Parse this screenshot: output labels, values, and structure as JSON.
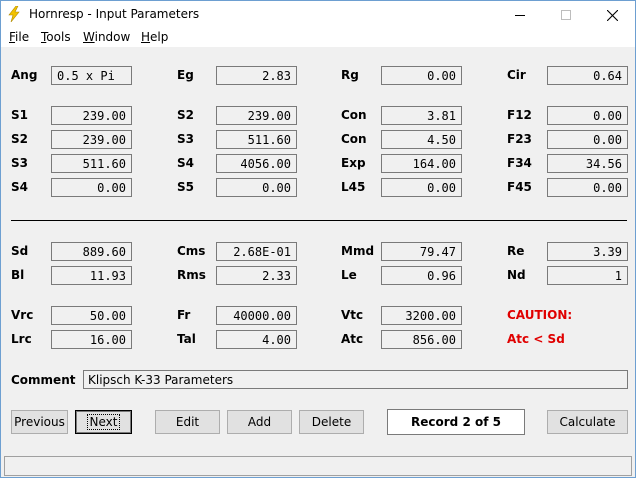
{
  "window": {
    "title": "Hornresp - Input Parameters",
    "app_icon": "lightning-bolt-icon",
    "controls": [
      "minimize-icon",
      "maximize-icon",
      "close-icon"
    ]
  },
  "menu": {
    "file": {
      "accel": "F",
      "rest": "ile"
    },
    "tools": {
      "accel": "T",
      "rest": "ools"
    },
    "window": {
      "accel": "W",
      "rest": "indow"
    },
    "help": {
      "accel": "H",
      "rest": "elp"
    }
  },
  "params": {
    "ang": {
      "label": "Ang",
      "value": "0.5 x Pi"
    },
    "eg": {
      "label": "Eg",
      "value": "2.83"
    },
    "rg": {
      "label": "Rg",
      "value": "0.00"
    },
    "cir": {
      "label": "Cir",
      "value": "0.64"
    },
    "s1": {
      "label": "S1",
      "value": "239.00"
    },
    "s2a": {
      "label": "S2",
      "value": "239.00"
    },
    "con1": {
      "label": "Con",
      "value": "3.81"
    },
    "f12": {
      "label": "F12",
      "value": "0.00"
    },
    "s2": {
      "label": "S2",
      "value": "239.00"
    },
    "s3a": {
      "label": "S3",
      "value": "511.60"
    },
    "con2": {
      "label": "Con",
      "value": "4.50"
    },
    "f23": {
      "label": "F23",
      "value": "0.00"
    },
    "s3": {
      "label": "S3",
      "value": "511.60"
    },
    "s4a": {
      "label": "S4",
      "value": "4056.00"
    },
    "exp": {
      "label": "Exp",
      "value": "164.00"
    },
    "f34": {
      "label": "F34",
      "value": "34.56"
    },
    "s4": {
      "label": "S4",
      "value": "0.00"
    },
    "s5": {
      "label": "S5",
      "value": "0.00"
    },
    "l45": {
      "label": "L45",
      "value": "0.00"
    },
    "f45": {
      "label": "F45",
      "value": "0.00"
    },
    "sd": {
      "label": "Sd",
      "value": "889.60"
    },
    "cms": {
      "label": "Cms",
      "value": "2.68E-01"
    },
    "mmd": {
      "label": "Mmd",
      "value": "79.47"
    },
    "re": {
      "label": "Re",
      "value": "3.39"
    },
    "bl": {
      "label": "Bl",
      "value": "11.93"
    },
    "rms": {
      "label": "Rms",
      "value": "2.33"
    },
    "le": {
      "label": "Le",
      "value": "0.96"
    },
    "nd": {
      "label": "Nd",
      "value": "1"
    },
    "vrc": {
      "label": "Vrc",
      "value": "50.00"
    },
    "fr": {
      "label": "Fr",
      "value": "40000.00"
    },
    "vtc": {
      "label": "Vtc",
      "value": "3200.00"
    },
    "lrc": {
      "label": "Lrc",
      "value": "16.00"
    },
    "tal": {
      "label": "Tal",
      "value": "4.00"
    },
    "atc": {
      "label": "Atc",
      "value": "856.00"
    }
  },
  "caution": {
    "title": "CAUTION:",
    "message": "Atc < Sd",
    "color": "#e00000"
  },
  "comment": {
    "label": "Comment",
    "value": "Klipsch K-33 Parameters"
  },
  "buttons": {
    "previous": "Previous",
    "next": "Next",
    "edit": "Edit",
    "add": "Add",
    "delete": "Delete",
    "calculate": "Calculate"
  },
  "record": "Record 2 of 5"
}
